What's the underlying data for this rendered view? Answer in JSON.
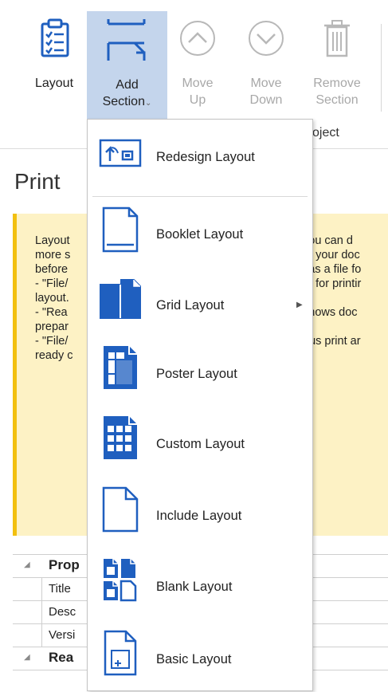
{
  "ribbon": {
    "buttons": [
      {
        "label_line1": "Layout",
        "label_line2": "",
        "icon": "clipboard-list-icon"
      },
      {
        "label_line1": "Add",
        "label_line2": "Section",
        "icon": "add-section-icon",
        "has_dropdown": true
      },
      {
        "label_line1": "Move",
        "label_line2": "Up",
        "icon": "arrow-up-circle-icon"
      },
      {
        "label_line1": "Move",
        "label_line2": "Down",
        "icon": "arrow-down-circle-icon"
      },
      {
        "label_line1": "Remove",
        "label_line2": "Section",
        "icon": "trash-icon"
      }
    ],
    "group_label": "oject",
    "accent_color": "#1f5fbf",
    "active_bg": "#c4d5ec"
  },
  "page": {
    "title": "Print",
    "note_lines_left": [
      "Layout",
      "more s",
      "before",
      "- \"File/",
      "layout.",
      "- \"Rea",
      "prepar",
      "- \"File/",
      "ready c"
    ],
    "note_lines_right": [
      "you can d",
      "ut your doc",
      "l as a file fo",
      "nt for printir",
      "",
      "shows doc",
      "",
      "hus print ar",
      ""
    ],
    "note_bg": "#fdf2c5",
    "note_border": "#f2c00f",
    "properties": [
      {
        "text": "Prop",
        "group": true
      },
      {
        "text": "Title",
        "group": false
      },
      {
        "text": "Desc",
        "group": false
      },
      {
        "text": "Versi",
        "group": false
      },
      {
        "text": "Rea",
        "group": true
      }
    ]
  },
  "menu": {
    "items": [
      {
        "label": "Redesign Layout",
        "icon": "redesign-layout-icon"
      },
      {
        "label": "Booklet Layout",
        "icon": "booklet-layout-icon"
      },
      {
        "label": "Grid Layout",
        "icon": "grid-layout-icon",
        "submenu": true
      },
      {
        "label": "Poster Layout",
        "icon": "poster-layout-icon"
      },
      {
        "label": "Custom Layout",
        "icon": "custom-layout-icon"
      },
      {
        "label": "Include Layout",
        "icon": "include-layout-icon"
      },
      {
        "label": "Blank Layout",
        "icon": "blank-layout-icon"
      },
      {
        "label": "Basic Layout",
        "icon": "basic-layout-icon"
      }
    ]
  }
}
